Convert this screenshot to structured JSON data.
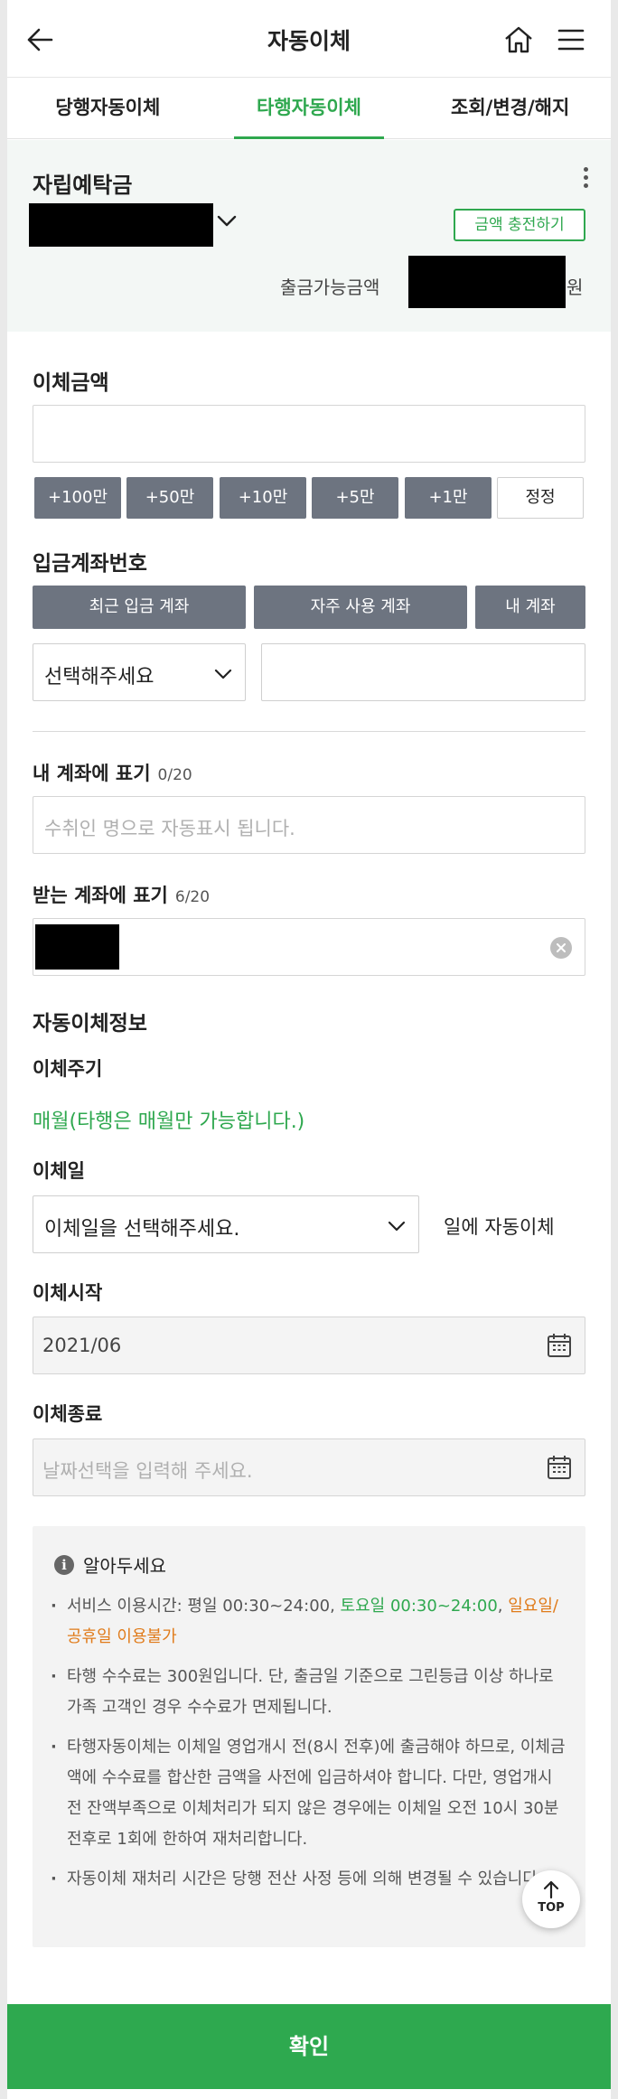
{
  "header": {
    "title": "자동이체",
    "back_icon": "back-arrow-icon",
    "home_icon": "home-icon",
    "menu_icon": "hamburger-menu-icon"
  },
  "tabs": [
    {
      "label": "당행자동이체",
      "active": false
    },
    {
      "label": "타행자동이체",
      "active": true
    },
    {
      "label": "조회/변경/해지",
      "active": false
    }
  ],
  "account": {
    "name": "자립예탁금",
    "charge_button": "금액 충전하기",
    "available_label": "출금가능금액",
    "currency_unit": "원"
  },
  "amount": {
    "label": "이체금액",
    "value": "",
    "quick_buttons": [
      "+100만",
      "+50만",
      "+10만",
      "+5만",
      "+1만"
    ],
    "correct_button": "정정"
  },
  "deposit_account": {
    "label": "입금계좌번호",
    "buttons": [
      "최근 입금 계좌",
      "자주 사용 계좌",
      "내 계좌"
    ],
    "bank_select": "선택해주세요",
    "account_number": ""
  },
  "my_memo": {
    "label": "내 계좌에 표기",
    "count": "0/20",
    "placeholder": "수취인 명으로 자동표시 됩니다."
  },
  "recipient_memo": {
    "label": "받는 계좌에 표기",
    "count": "6/20"
  },
  "transfer_info": {
    "title": "자동이체정보",
    "cycle_label": "이체주기",
    "cycle_value": "매월(타행은 매월만 가능합니다.)",
    "day_label": "이체일",
    "day_select": "이체일을 선택해주세요.",
    "day_suffix": "일에 자동이체",
    "start_label": "이체시작",
    "start_value": "2021/06",
    "end_label": "이체종료",
    "end_placeholder": "날짜선택을 입력해 주세요."
  },
  "notice": {
    "title": "알아두세요",
    "b1_a": "서비스 이용시간: 평일 00:30~24:00, ",
    "b1_b": "토요일 00:30~24:00",
    "b1_c": ", ",
    "b1_d": "일요일/공휴일 이용불가",
    "b2": "타행 수수료는 300원입니다. 단, 출금일 기준으로 그린등급 이상 하나로가족 고객인 경우 수수료가 면제됩니다.",
    "b3": "타행자동이체는 이체일 영업개시 전(8시 전후)에 출금해야 하므로, 이체금액에 수수료를 합산한 금액을 사전에 입금하셔야 합니다. 다만, 영업개시 전 잔액부족으로 이체처리가 되지 않은 경우에는 이체일 오전 10시 30분 전후로 1회에 한하여 재처리합니다.",
    "b4": "자동이체 재처리 시간은 당행 전산 사정 등에 의해 변경될 수 있습니다."
  },
  "top_button": "TOP",
  "confirm_button": "확인",
  "colors": {
    "accent_green": "#2fa84f",
    "orange": "#e07b1a",
    "button_gray": "#6d7480"
  }
}
